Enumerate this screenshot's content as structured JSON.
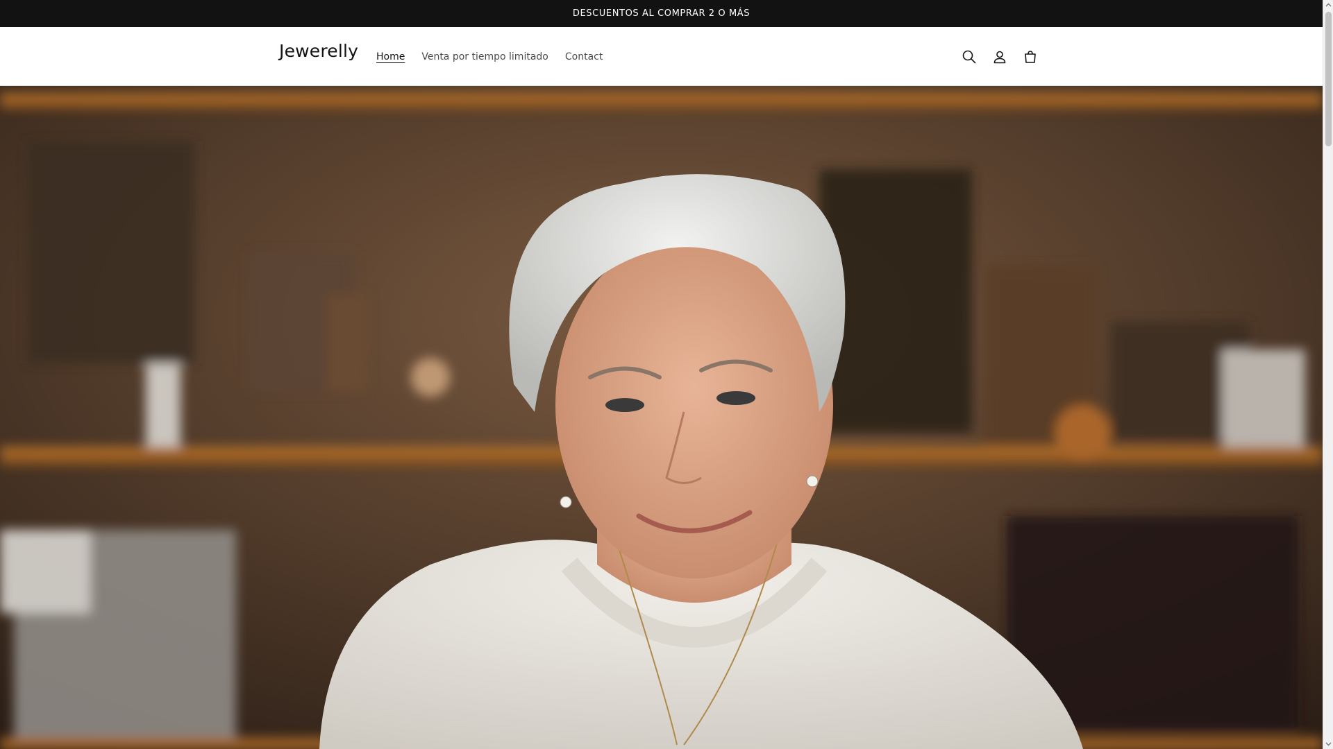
{
  "announcement": {
    "text": "DESCUENTOS AL COMPRAR 2 O MÁS"
  },
  "header": {
    "logo": "Jewerelly",
    "nav": [
      {
        "label": "Home",
        "active": true
      },
      {
        "label": "Venta por tiempo limitado",
        "active": false
      },
      {
        "label": "Contact",
        "active": false
      }
    ],
    "icons": [
      "search-icon",
      "account-icon",
      "cart-icon"
    ]
  },
  "hero": {
    "image": "portrait-photo"
  },
  "colors": {
    "announcement_bg": "#121212",
    "announcement_text": "#ffffff",
    "text_primary": "#121212",
    "text_secondary": "#4a4a4a"
  }
}
